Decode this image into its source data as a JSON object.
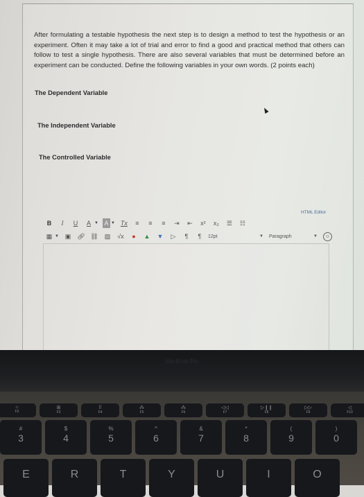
{
  "question": {
    "prompt": "After formulating a testable hypothesis the next step is to design a method to test the hypothesis or an experiment. Often it may take a lot of trial and error to find a good and practical method that others can follow to test a single hypothesis. There are also several variables that must be determined before an experiment can be conducted.  Define the following variables in your own words. (2 points each)",
    "variables": [
      "The Dependent Variable",
      "The Independent Variable",
      "The Controlled Variable"
    ]
  },
  "editor": {
    "html_editor_link": "HTML Editor",
    "toolbar_row1": {
      "bold": "B",
      "italic": "I",
      "underline": "U",
      "font_color": "A",
      "background_color": "A",
      "clear_formatting": "Tx",
      "superscript": "x²",
      "subscript": "x₂"
    },
    "font_size": "12pt",
    "block_format": "Paragraph",
    "content": ""
  },
  "device": {
    "bezel_label": "MacBook Pro",
    "function_keys": [
      {
        "glyph": "☼",
        "label": "F2"
      },
      {
        "glyph": "⊞",
        "label": "F3"
      },
      {
        "glyph": "⠿",
        "label": "F4"
      },
      {
        "glyph": "⁂",
        "label": "F5"
      },
      {
        "glyph": "⁂",
        "label": "F6"
      },
      {
        "glyph": "◁◁",
        "label": "F7"
      },
      {
        "glyph": "▷❙❙",
        "label": "F8"
      },
      {
        "glyph": "▷▷",
        "label": "F9"
      },
      {
        "glyph": "◁",
        "label": "F10"
      }
    ],
    "number_keys": [
      {
        "top": "#",
        "bottom": "3"
      },
      {
        "top": "$",
        "bottom": "4"
      },
      {
        "top": "%",
        "bottom": "5"
      },
      {
        "top": "^",
        "bottom": "6"
      },
      {
        "top": "&",
        "bottom": "7"
      },
      {
        "top": "*",
        "bottom": "8"
      },
      {
        "top": "(",
        "bottom": "9"
      },
      {
        "top": ")",
        "bottom": "0"
      }
    ],
    "letter_keys": [
      "E",
      "R",
      "T",
      "Y",
      "U",
      "I",
      "O"
    ]
  }
}
